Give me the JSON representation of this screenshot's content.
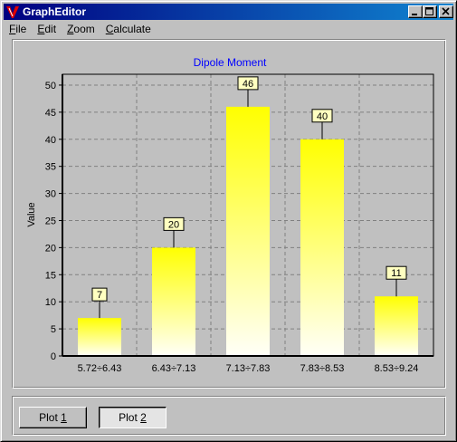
{
  "window": {
    "title": "GraphEditor",
    "minimize_icon": "minimize-icon",
    "maximize_icon": "maximize-icon",
    "close_icon": "close-icon"
  },
  "menu": [
    {
      "pre": "",
      "acc": "F",
      "post": "ile"
    },
    {
      "pre": "",
      "acc": "E",
      "post": "dit"
    },
    {
      "pre": "",
      "acc": "Z",
      "post": "oom"
    },
    {
      "pre": "",
      "acc": "C",
      "post": "alculate"
    }
  ],
  "buttons": {
    "plot1": {
      "pre": "Plot ",
      "acc": "1"
    },
    "plot2": {
      "pre": "Plot ",
      "acc": "2"
    }
  },
  "chart_data": {
    "type": "bar",
    "title": "Dipole Moment",
    "xlabel": "",
    "ylabel": "Value",
    "categories": [
      "5.72÷6.43",
      "6.43÷7.13",
      "7.13÷7.83",
      "7.83÷8.53",
      "8.53÷9.24"
    ],
    "values": [
      7,
      20,
      46,
      40,
      11
    ],
    "ylim": [
      0,
      52
    ],
    "yticks": [
      0,
      5,
      10,
      15,
      20,
      25,
      30,
      35,
      40,
      45,
      50
    ],
    "grid": true,
    "data_labels": true,
    "colors": {
      "title": "#0000ff",
      "bar_top": "#ffff00",
      "bar_bottom": "#fffff8",
      "label_bg": "#ffffc0",
      "grid": "#808080"
    }
  }
}
